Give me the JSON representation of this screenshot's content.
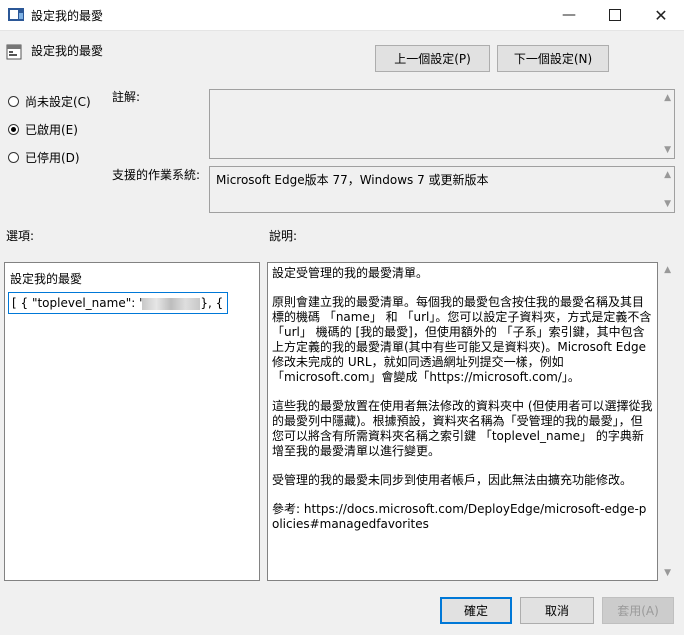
{
  "window": {
    "title": "設定我的最愛",
    "icons": {
      "app": "policy-editor-icon",
      "minimize": "minimize-icon",
      "maximize": "maximize-icon",
      "close": "close-icon"
    }
  },
  "setting": {
    "name": "設定我的最愛",
    "prev_button": "上一個設定(P)",
    "next_button": "下一個設定(N)"
  },
  "state": {
    "options": [
      {
        "label": "尚未設定(C)",
        "checked": false
      },
      {
        "label": "已啟用(E)",
        "checked": true
      },
      {
        "label": "已停用(D)",
        "checked": false
      }
    ]
  },
  "comment": {
    "label": "註解:",
    "value": ""
  },
  "supported": {
    "label": "支援的作業系統:",
    "value": "Microsoft Edge版本 77，Windows 7 或更新版本"
  },
  "options_section": {
    "label": "選項:",
    "field_label": "設定我的最愛",
    "field_value_prefix": "[ {  \"toplevel_name\": '",
    "field_value_suffix": "},  {"
  },
  "help_section": {
    "label": "說明:",
    "paragraphs": [
      "設定受管理的我的最愛清單。",
      "原則會建立我的最愛清單。每個我的最愛包含按住我的最愛名稱及其目標的機碼 「name」 和 「url」。您可以設定子資料夾，方式是定義不含 「url」 機碼的 [我的最愛]，但使用額外的 「子系」索引鍵，其中包含上方定義的我的最愛清單(其中有些可能又是資料夾)。Microsoft Edge修改未完成的 URL，就如同透過網址列提交一樣，例如「microsoft.com」會變成「https://microsoft.com/」。",
      "這些我的最愛放置在使用者無法修改的資料夾中 (但使用者可以選擇從我的最愛列中隱藏)。根據預設，資料夾名稱為「受管理的我的最愛」，但您可以將含有所需資料夾名稱之索引鍵 「toplevel_name」 的字典新增至我的最愛清單以進行變更。",
      "受管理的我的最愛未同步到使用者帳戶，因此無法由擴充功能修改。",
      "參考: https://docs.microsoft.com/DeployEdge/microsoft-edge-policies#managedfavorites"
    ]
  },
  "footer": {
    "ok": "確定",
    "cancel": "取消",
    "apply": "套用(A)"
  }
}
